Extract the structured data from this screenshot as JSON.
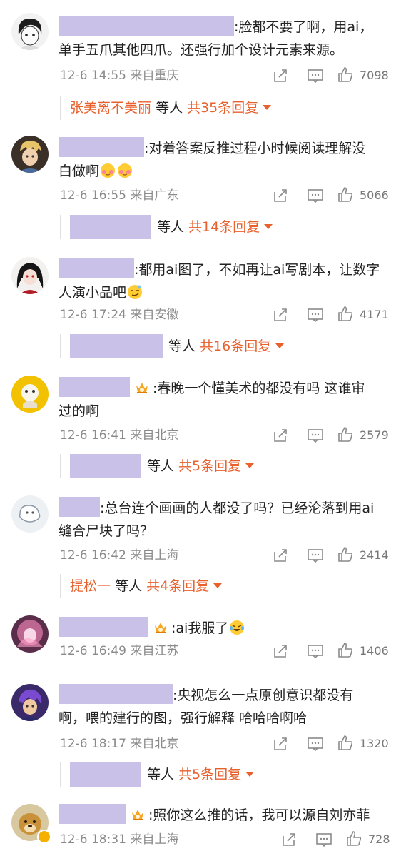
{
  "comments": [
    {
      "text_line1": ":脸都不要了啊，用ai，",
      "text_line2": "单手五爪其他四爪。还强行加个设计元素来源。",
      "time": "12-6 14:55 来自重庆",
      "likes": "7098",
      "reply_name": "张美离不美丽",
      "reply_mid": "等人",
      "reply_total": "共35条回复"
    },
    {
      "text_line1": ":对着答案反推过程小时候阅读理解没",
      "text_line2": "白做啊",
      "time": "12-6 16:55 来自广东",
      "likes": "5066",
      "reply_mid": "等人",
      "reply_total": "共14条回复"
    },
    {
      "text_line1": ":都用ai图了，不如再让ai写剧本，让数字",
      "text_line2": "人演小品吧",
      "time": "12-6 17:24 来自安徽",
      "likes": "4171",
      "reply_mid": "等人",
      "reply_total": "共16条回复"
    },
    {
      "text_line1": ":春晚一个懂美术的都没有吗  这谁审",
      "text_line2": "过的啊",
      "time": "12-6 16:41 来自北京",
      "likes": "2579",
      "reply_mid": "等人",
      "reply_total": "共5条回复"
    },
    {
      "text_line1": ":总台连个画画的人都没了吗？已经沦落到用ai",
      "text_line2": "缝合尸块了吗？",
      "time": "12-6 16:42 来自上海",
      "likes": "2414",
      "reply_name": "提松一",
      "reply_mid": "等人",
      "reply_total": "共4条回复"
    },
    {
      "text_line1": ":ai我服了",
      "time": "12-6 16:49 来自江苏",
      "likes": "1406"
    },
    {
      "text_line1": ":央视怎么一点原创意识都没有",
      "text_line2": "啊，喂的建行的图，强行解释  哈哈哈啊哈",
      "time": "12-6 18:17 来自北京",
      "likes": "1320",
      "reply_mid": "等人",
      "reply_total": "共5条回复"
    },
    {
      "text_line1": ":照你这么推的话，我可以源自刘亦菲",
      "time": "12-6 18:31 来自上海",
      "likes": "728"
    }
  ],
  "icons": {
    "share": "share-icon",
    "reply": "comment-icon",
    "like": "thumbs-up-icon",
    "caret": "caret-down-icon"
  },
  "colors": {
    "accent": "#e8602c",
    "mask": "#c9c1e8",
    "meta": "#8a8a8a"
  }
}
